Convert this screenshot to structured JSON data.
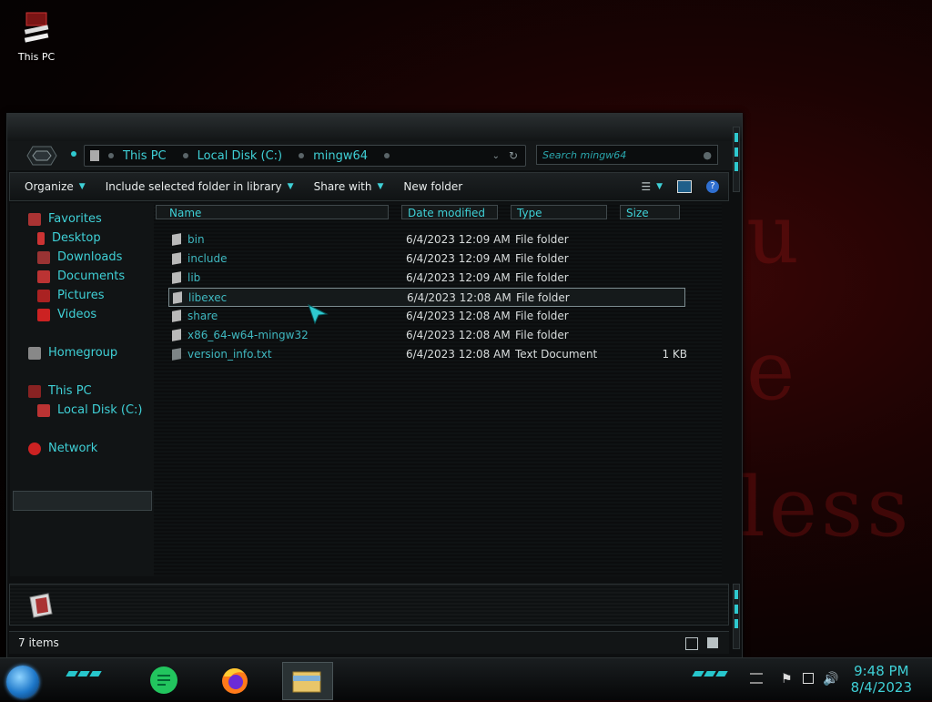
{
  "desktop": {
    "icon_label": "This PC"
  },
  "window": {
    "breadcrumb": [
      "This PC",
      "Local Disk (C:)",
      "mingw64"
    ],
    "search_placeholder": "Search mingw64",
    "toolbar": {
      "organize": "Organize",
      "include_library": "Include selected folder in library",
      "share_with": "Share with",
      "new_folder": "New folder"
    },
    "nav": {
      "favorites": "Favorites",
      "desktop": "Desktop",
      "downloads": "Downloads",
      "documents": "Documents",
      "pictures": "Pictures",
      "videos": "Videos",
      "homegroup": "Homegroup",
      "this_pc": "This PC",
      "local_disk": "Local Disk (C:)",
      "network": "Network"
    },
    "columns": {
      "name": "Name",
      "date": "Date modified",
      "type": "Type",
      "size": "Size"
    },
    "files": [
      {
        "name": "bin",
        "date": "6/4/2023 12:09 AM",
        "type": "File folder",
        "size": ""
      },
      {
        "name": "include",
        "date": "6/4/2023 12:09 AM",
        "type": "File folder",
        "size": ""
      },
      {
        "name": "lib",
        "date": "6/4/2023 12:09 AM",
        "type": "File folder",
        "size": ""
      },
      {
        "name": "libexec",
        "date": "6/4/2023 12:08 AM",
        "type": "File folder",
        "size": ""
      },
      {
        "name": "share",
        "date": "6/4/2023 12:08 AM",
        "type": "File folder",
        "size": ""
      },
      {
        "name": "x86_64-w64-mingw32",
        "date": "6/4/2023 12:08 AM",
        "type": "File folder",
        "size": ""
      },
      {
        "name": "version_info.txt",
        "date": "6/4/2023 12:08 AM",
        "type": "Text Document",
        "size": "1 KB"
      }
    ],
    "status": "7 items"
  },
  "taskbar": {
    "time": "9:48 PM",
    "date": "8/4/2023"
  },
  "colors": {
    "accent": "#3fd0d6",
    "window_bg": "#0d0f10",
    "desktop_red": "#3a0606"
  }
}
